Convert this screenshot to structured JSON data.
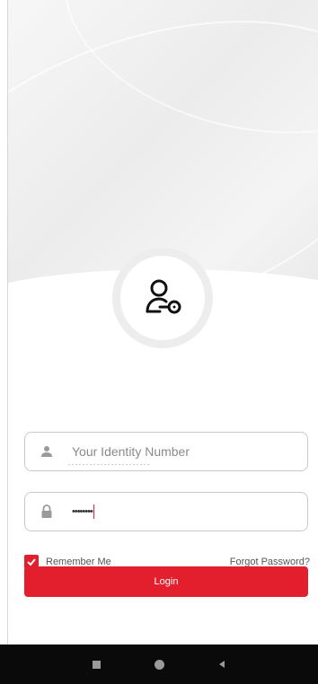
{
  "login_form": {
    "identity_placeholder": "Your Identity Number",
    "password_value": "••••••••",
    "remember_label": "Remember Me",
    "remember_checked": true,
    "forgot_label": "Forgot Password?",
    "login_label": "Login"
  },
  "icons": {
    "avatar": "user-key-icon",
    "identity": "person-icon",
    "password": "lock-icon",
    "nav_recent": "square-icon",
    "nav_home": "circle-icon",
    "nav_back": "triangle-back-icon"
  },
  "colors": {
    "accent": "#e31e2d",
    "nav_bar": "#0a0a0a"
  }
}
